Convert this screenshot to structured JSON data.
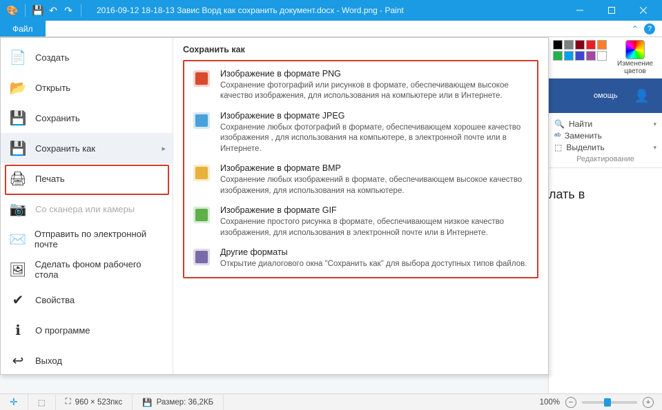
{
  "titlebar": {
    "title": "2016-09-12 18-18-13 Завис Ворд как сохранить документ.docx - Word.png - Paint"
  },
  "ribbon": {
    "file_tab": "Файл"
  },
  "colors_group": {
    "edit_label": "Изменение цветов"
  },
  "word_strip": {
    "help_label": "омощь"
  },
  "word_tools": {
    "find": "Найти",
    "replace": "Заменить",
    "select": "Выделить",
    "group": "Редактирование"
  },
  "word_doc": {
    "fragment": "лать в"
  },
  "file_menu": {
    "items": [
      {
        "label": "Создать",
        "icon": "new"
      },
      {
        "label": "Открыть",
        "icon": "open"
      },
      {
        "label": "Сохранить",
        "icon": "save"
      },
      {
        "label": "Сохранить как",
        "icon": "saveas",
        "selected": true
      },
      {
        "label": "Печать",
        "icon": "print"
      },
      {
        "label": "Со сканера или камеры",
        "icon": "scanner",
        "disabled": true
      },
      {
        "label": "Отправить по электронной почте",
        "icon": "email"
      },
      {
        "label": "Сделать фоном рабочего стола",
        "icon": "wallpaper"
      },
      {
        "label": "Свойства",
        "icon": "properties"
      },
      {
        "label": "О программе",
        "icon": "about"
      },
      {
        "label": "Выход",
        "icon": "exit"
      }
    ],
    "submenu_title": "Сохранить как",
    "save_options": [
      {
        "title": "Изображение в формате PNG",
        "desc": "Сохранение фотографий или рисунков в формате, обеспечивающем высокое качество изображения, для использования на компьютере или в Интернете.",
        "icon": "png"
      },
      {
        "title": "Изображение в формате JPEG",
        "desc": "Сохранение любых фотографий в формате, обеспечивающем хорошее качество изображения , для использования на компьютере, в электронной почте или в Интернете.",
        "icon": "jpeg"
      },
      {
        "title": "Изображение в формате BMP",
        "desc": "Сохранение любых изображений в формате, обеспечивающем высокое качество изображения, для использования на компьютере.",
        "icon": "bmp"
      },
      {
        "title": "Изображение в формате GIF",
        "desc": "Сохранение простого рисунка в формате, обеспечивающем низкое качество изображения, для использования в электронной почте или в Интернете.",
        "icon": "gif"
      },
      {
        "title": "Другие форматы",
        "desc": "Открытие диалогового окна \"Сохранить как\" для выбора доступных типов файлов.",
        "icon": "other"
      }
    ]
  },
  "statusbar": {
    "pos_icon": "✛",
    "canvas_dims": "960 × 523пкс",
    "size_label": "Размер: 36,2КБ",
    "zoom_pct": "100%"
  },
  "palette": [
    "#000000",
    "#7f7f7f",
    "#880015",
    "#ed1c24",
    "#ff7f27",
    "#22b14c",
    "#00a2e8",
    "#3f48cc",
    "#a349a4",
    "#ffffff",
    "#c3c3c3",
    "#b97a57",
    "#ffaec9",
    "#ffc90e",
    "#b5e61d",
    "#99d9ea",
    "#7092be",
    "#c8bfe7"
  ]
}
